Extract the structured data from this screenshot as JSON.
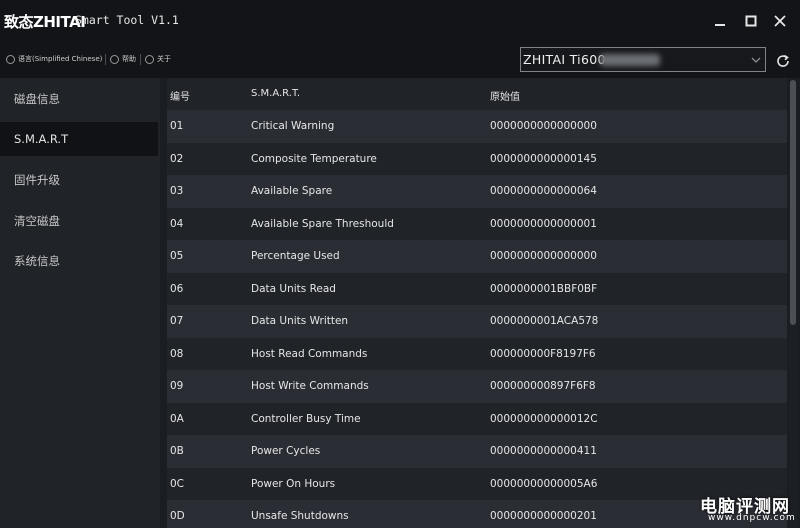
{
  "app": {
    "brand": "致态ZHITAI",
    "title": "Smart Tool V1.1"
  },
  "toolbar": {
    "language": "语言(Simplified Chinese)",
    "help": "帮助",
    "about": "关于"
  },
  "device": {
    "selected": "ZHITAI Ti600"
  },
  "sidebar": {
    "items": [
      {
        "label": "磁盘信息"
      },
      {
        "label": "S.M.A.R.T"
      },
      {
        "label": "固件升级"
      },
      {
        "label": "清空磁盘"
      },
      {
        "label": "系统信息"
      }
    ]
  },
  "table": {
    "headers": {
      "id": "编号",
      "name": "S.M.A.R.T.",
      "raw": "原始值"
    },
    "rows": [
      {
        "id": "01",
        "name": "Critical Warning",
        "raw": "0000000000000000"
      },
      {
        "id": "02",
        "name": "Composite Temperature",
        "raw": "0000000000000145"
      },
      {
        "id": "03",
        "name": "Available Spare",
        "raw": "0000000000000064"
      },
      {
        "id": "04",
        "name": "Available Spare Threshould",
        "raw": "0000000000000001"
      },
      {
        "id": "05",
        "name": "Percentage Used",
        "raw": "0000000000000000"
      },
      {
        "id": "06",
        "name": "Data Units Read",
        "raw": "0000000001BBF0BF"
      },
      {
        "id": "07",
        "name": "Data Units Written",
        "raw": "0000000001ACA578"
      },
      {
        "id": "08",
        "name": "Host Read Commands",
        "raw": "000000000F8197F6"
      },
      {
        "id": "09",
        "name": "Host Write Commands",
        "raw": "000000000897F6F8"
      },
      {
        "id": "0A",
        "name": "Controller Busy Time",
        "raw": "000000000000012C"
      },
      {
        "id": "0B",
        "name": "Power Cycles",
        "raw": "0000000000000411"
      },
      {
        "id": "0C",
        "name": "Power On Hours",
        "raw": "00000000000005A6"
      },
      {
        "id": "0D",
        "name": "Unsafe Shutdowns",
        "raw": "0000000000000201"
      }
    ]
  },
  "watermark": {
    "line1": "电脑评测网",
    "line2": "www.dnpcw.com"
  }
}
